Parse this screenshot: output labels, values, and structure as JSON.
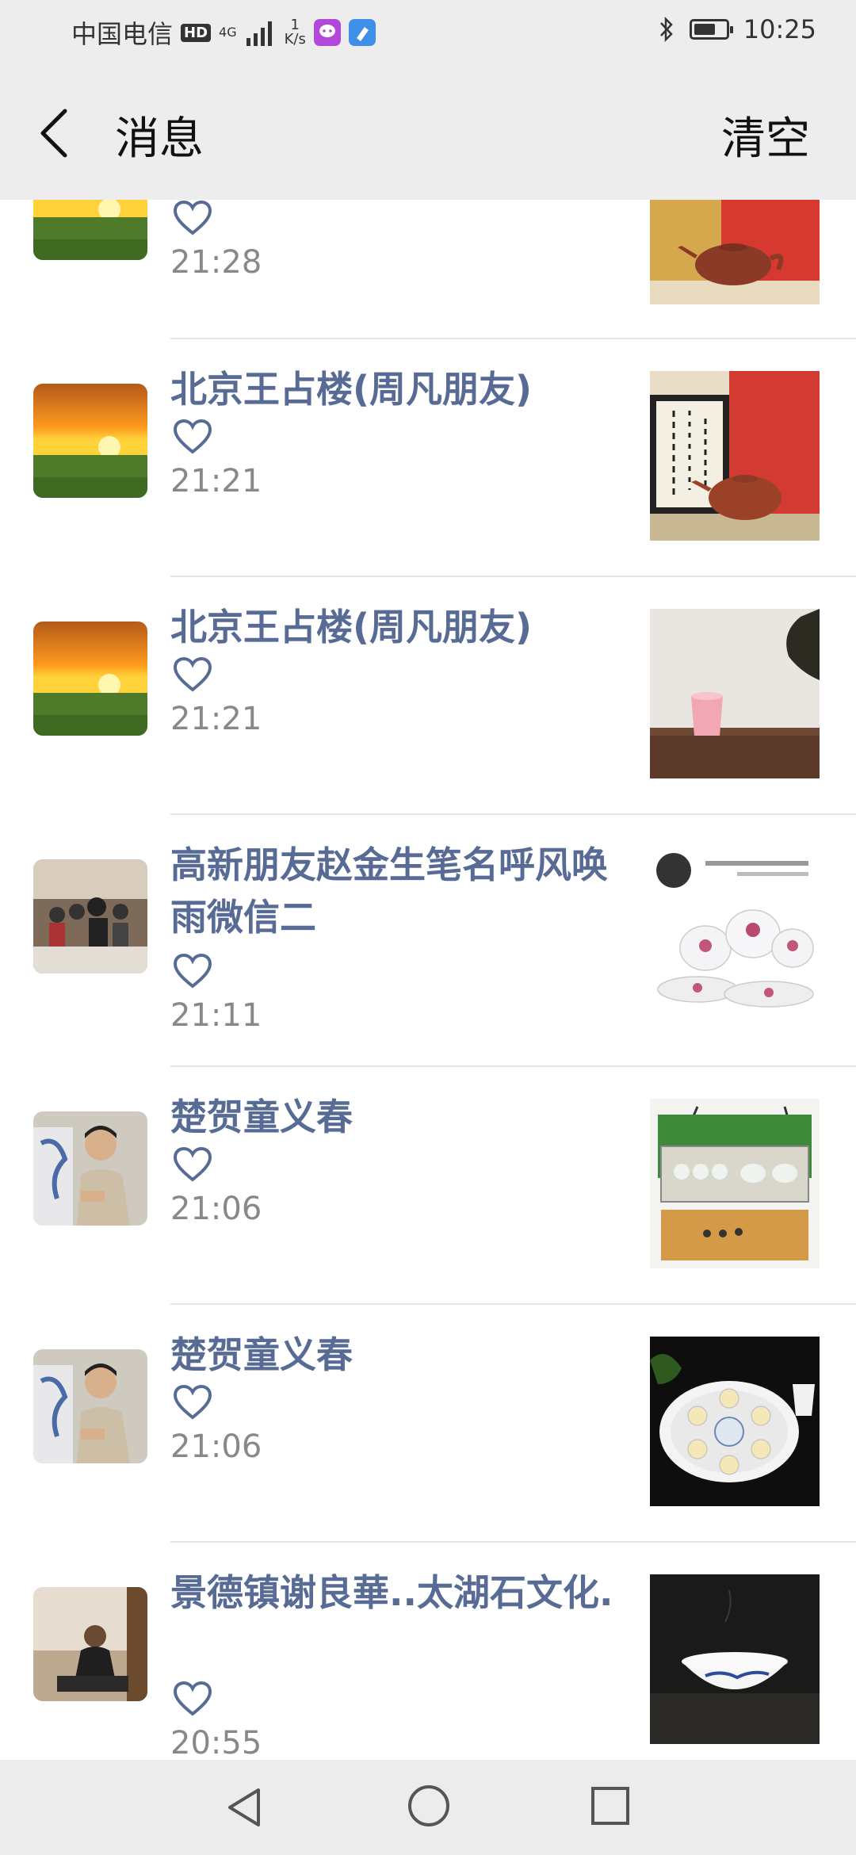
{
  "status_bar": {
    "carrier": "中国电信",
    "hd_badge": "HD",
    "network": "4G",
    "speed_value": "1",
    "speed_unit": "K/s",
    "time": "10:25",
    "icons": [
      "signal-icon",
      "messaging-app-icon",
      "cleaner-app-icon",
      "bluetooth-icon",
      "battery-icon"
    ]
  },
  "header": {
    "title": "消息",
    "clear_label": "清空",
    "back_icon": "chevron-left-icon"
  },
  "messages": [
    {
      "name": "",
      "time": "21:28",
      "avatar": "sunset-field",
      "thumbnail": "teapot-red-box"
    },
    {
      "name": "北京王占楼(周凡朋友)",
      "time": "21:21",
      "avatar": "sunset-field",
      "thumbnail": "teapot-calligraphy"
    },
    {
      "name": "北京王占楼(周凡朋友)",
      "time": "21:21",
      "avatar": "sunset-field",
      "thumbnail": "pink-cup"
    },
    {
      "name": "高新朋友赵金生笔名呼风唤雨微信二",
      "time": "21:11",
      "avatar": "meeting-room",
      "thumbnail": "tableware-set"
    },
    {
      "name": "楚贺童义春",
      "time": "21:06",
      "avatar": "man-with-vase",
      "thumbnail": "tea-set-box"
    },
    {
      "name": "楚贺童义春",
      "time": "21:06",
      "avatar": "man-with-vase",
      "thumbnail": "tea-tray"
    },
    {
      "name": "景德镇谢良華..太湖石文化.",
      "time": "20:55",
      "avatar": "man-sitting",
      "thumbnail": "blue-white-bowl"
    }
  ],
  "nav": {
    "back_icon": "triangle-back-icon",
    "home_icon": "circle-home-icon",
    "recent_icon": "square-recent-icon"
  },
  "colors": {
    "name": "#576b95",
    "bar_bg": "#ededed",
    "time": "#888888"
  }
}
